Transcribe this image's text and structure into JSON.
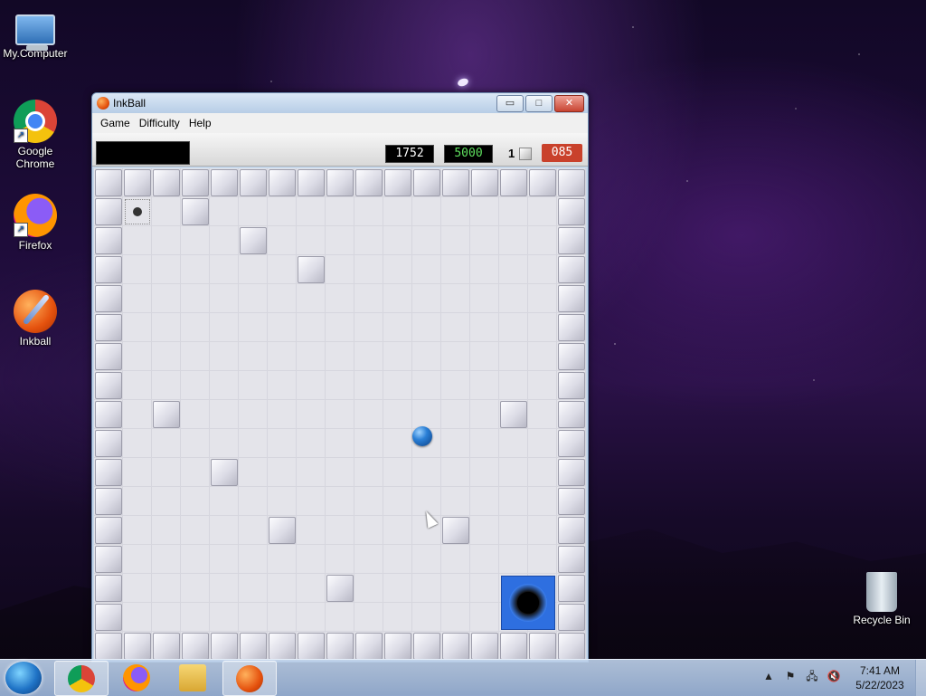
{
  "desktop": {
    "icons": [
      {
        "label": "My.Computer"
      },
      {
        "label": "Google Chrome"
      },
      {
        "label": "Firefox"
      },
      {
        "label": "Inkball"
      },
      {
        "label": "Recycle Bin"
      }
    ]
  },
  "window": {
    "title": "InkBall",
    "controls": {
      "minimize": "▭",
      "maximize": "□",
      "close": "✕"
    },
    "menu": [
      "Game",
      "Difficulty",
      "Help"
    ],
    "scorebar": {
      "score": "1752",
      "target": "5000",
      "balls_remaining": "1",
      "timer": "085"
    }
  },
  "taskbar": {
    "items": [
      "Google Chrome",
      "Firefox",
      "File Explorer",
      "InkBall"
    ],
    "tray": {
      "overflow": "▲",
      "time": "7:41 AM",
      "date": "5/22/2023"
    }
  },
  "icons": {
    "start": "windows-logo-icon",
    "computer": "computer-icon",
    "chrome": "chrome-icon",
    "firefox": "firefox-icon",
    "inkball": "inkball-icon",
    "recycle_bin": "recycle-bin-icon"
  },
  "colors": {
    "score_green": "#5fe05f",
    "timer_red": "#c9412b",
    "hole_blue": "#2e6fe0",
    "ball_blue": "#2a7fd6"
  }
}
